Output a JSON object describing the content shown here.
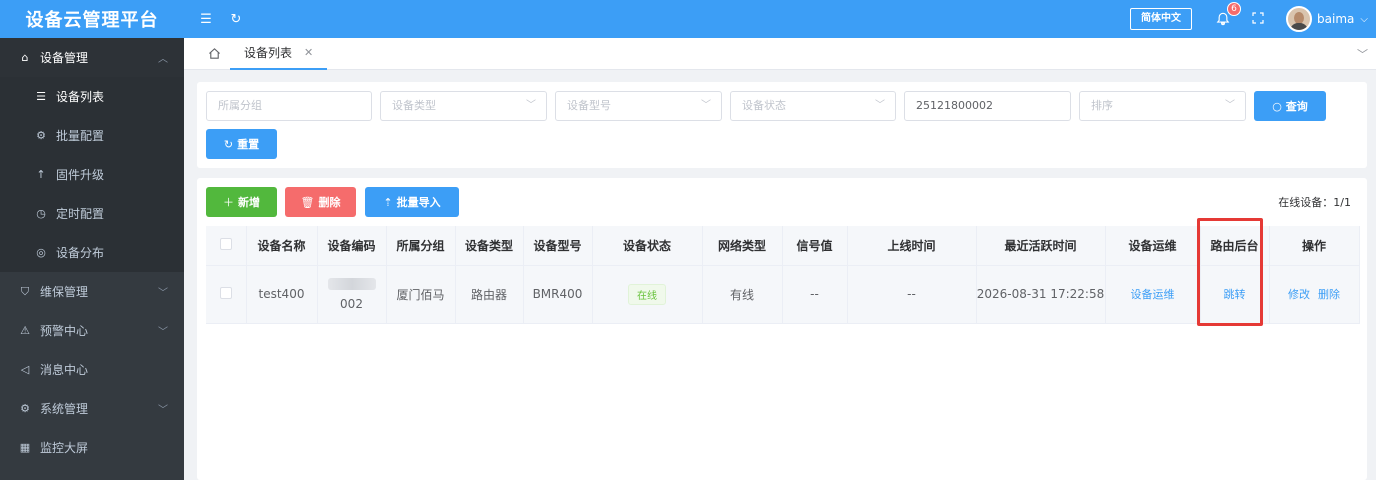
{
  "app": {
    "title": "设备云管理平台",
    "language_button": "简体中文",
    "notification_count": "6",
    "username": "baima"
  },
  "sidebar": {
    "items": [
      {
        "label": "设备管理",
        "icon": "device-icon"
      },
      {
        "label": "设备列表",
        "icon": "list-icon"
      },
      {
        "label": "批量配置",
        "icon": "gear-icon"
      },
      {
        "label": "固件升级",
        "icon": "arrow-up-icon"
      },
      {
        "label": "定时配置",
        "icon": "clock-icon"
      },
      {
        "label": "设备分布",
        "icon": "location-icon"
      },
      {
        "label": "维保管理",
        "icon": "shield-icon"
      },
      {
        "label": "预警中心",
        "icon": "alarm-icon"
      },
      {
        "label": "消息中心",
        "icon": "speaker-icon"
      },
      {
        "label": "系统管理",
        "icon": "settings-icon"
      },
      {
        "label": "监控大屏",
        "icon": "grid-icon"
      }
    ]
  },
  "tabs": {
    "items": [
      {
        "label": "设备列表"
      }
    ]
  },
  "filters": {
    "group_placeholder": "所属分组",
    "type_placeholder": "设备类型",
    "model_placeholder": "设备型号",
    "status_placeholder": "设备状态",
    "serial_value": "25121800002",
    "sort_placeholder": "排序",
    "query_label": "查询",
    "reset_label": "重置"
  },
  "toolbar": {
    "add_label": "新增",
    "delete_label": "删除",
    "import_label": "批量导入",
    "online_devices": "在线设备：1/1"
  },
  "table": {
    "columns": [
      "设备名称",
      "设备编码",
      "所属分组",
      "设备类型",
      "设备型号",
      "设备状态",
      "网络类型",
      "信号值",
      "上线时间",
      "最近活跃时间",
      "设备运维",
      "路由后台",
      "操作"
    ],
    "rows": [
      {
        "name": "test400",
        "code": "002",
        "group": "厦门佰马",
        "type": "路由器",
        "model": "BMR400",
        "status": "在线",
        "network": "有线",
        "signal": "--",
        "online_time": "--",
        "last_active": "2026-08-31 17:22:58",
        "ops_link": "设备运维",
        "router_link": "跳转",
        "edit_link": "修改",
        "delete_link": "删除"
      }
    ]
  },
  "colors": {
    "primary": "#3c9ef6",
    "success": "#52b83d",
    "danger": "#f56c6c",
    "sidebar": "#343a40",
    "highlight": "#e53935"
  }
}
